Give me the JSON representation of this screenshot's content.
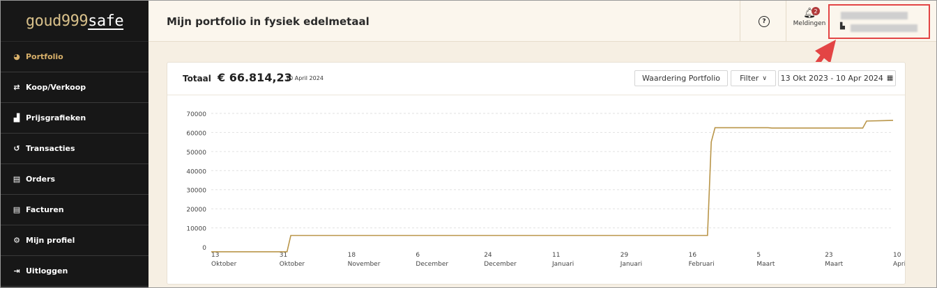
{
  "logo": {
    "part1": "goud999",
    "part2": "safe"
  },
  "sidebar": {
    "items": [
      {
        "label": "Portfolio",
        "icon": "pie-chart-icon",
        "glyph": "◕",
        "active": true
      },
      {
        "label": "Koop/Verkoop",
        "icon": "swap-arrows-icon",
        "glyph": "⇄"
      },
      {
        "label": "Prijsgrafieken",
        "icon": "bar-chart-icon",
        "glyph": "▟"
      },
      {
        "label": "Transacties",
        "icon": "history-icon",
        "glyph": "↺"
      },
      {
        "label": "Orders",
        "icon": "document-icon",
        "glyph": "▤"
      },
      {
        "label": "Facturen",
        "icon": "invoice-icon",
        "glyph": "▤"
      },
      {
        "label": "Mijn profiel",
        "icon": "gear-icon",
        "glyph": "⚙"
      },
      {
        "label": "Uitloggen",
        "icon": "logout-icon",
        "glyph": "⇥"
      }
    ]
  },
  "header": {
    "title": "Mijn portfolio in fysiek edelmetaal",
    "help_glyph": "?",
    "notifications": {
      "label": "Meldingen",
      "count": "2"
    }
  },
  "card": {
    "total_label": "Totaal",
    "total_value": "€ 66.814,23",
    "total_date": "10 April 2024",
    "waardering_label": "Waardering Portfolio",
    "filter_label": "Filter",
    "date_range": "13 Okt 2023 - 10 Apr 2024"
  },
  "colors": {
    "accent": "#b99548",
    "sidebar_bg": "#171717",
    "header_bg": "#fbf6ed",
    "highlight": "#e34444"
  },
  "chart_data": {
    "type": "line",
    "title": "",
    "xlabel": "",
    "ylabel": "",
    "ylim": [
      0,
      70000
    ],
    "yticks": [
      0,
      10000,
      20000,
      30000,
      40000,
      50000,
      60000,
      70000
    ],
    "xtick_labels": [
      [
        "13",
        "Oktober"
      ],
      [
        "31",
        "Oktober"
      ],
      [
        "18",
        "November"
      ],
      [
        "6",
        "December"
      ],
      [
        "24",
        "December"
      ],
      [
        "11",
        "Januari"
      ],
      [
        "29",
        "Januari"
      ],
      [
        "16",
        "Februari"
      ],
      [
        "5",
        "Maart"
      ],
      [
        "23",
        "Maart"
      ],
      [
        "10",
        "April"
      ]
    ],
    "x_range": [
      "2023-10-13",
      "2024-04-10"
    ],
    "series": [
      {
        "color": "#b99548",
        "points": [
          [
            "2023-10-13",
            -2500
          ],
          [
            "2023-11-02",
            -2500
          ],
          [
            "2023-11-03",
            6000
          ],
          [
            "2024-02-21",
            6000
          ],
          [
            "2024-02-22",
            55000
          ],
          [
            "2024-02-23",
            62500
          ],
          [
            "2024-03-08",
            62500
          ],
          [
            "2024-03-09",
            62300
          ],
          [
            "2024-04-02",
            62300
          ],
          [
            "2024-04-03",
            66000
          ],
          [
            "2024-04-10",
            66300
          ]
        ]
      }
    ]
  }
}
